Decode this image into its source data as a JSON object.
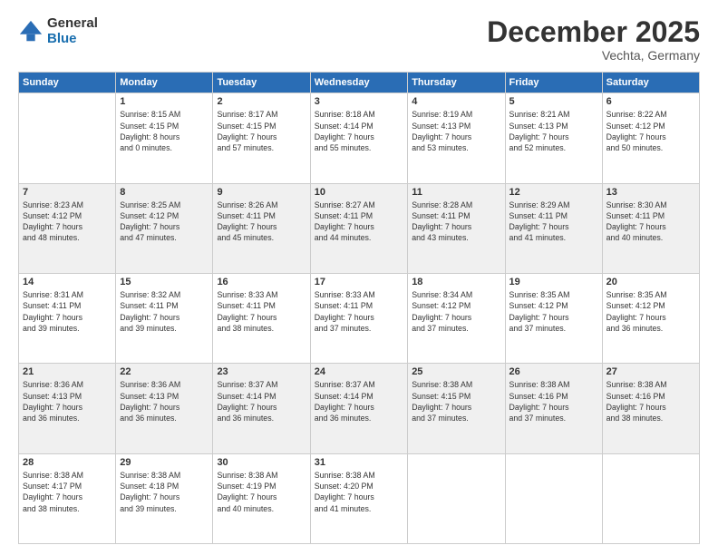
{
  "logo": {
    "general": "General",
    "blue": "Blue"
  },
  "header": {
    "month": "December 2025",
    "location": "Vechta, Germany"
  },
  "weekdays": [
    "Sunday",
    "Monday",
    "Tuesday",
    "Wednesday",
    "Thursday",
    "Friday",
    "Saturday"
  ],
  "weeks": [
    [
      {
        "day": "",
        "sunrise": "",
        "sunset": "",
        "daylight": ""
      },
      {
        "day": "1",
        "sunrise": "Sunrise: 8:15 AM",
        "sunset": "Sunset: 4:15 PM",
        "daylight": "Daylight: 8 hours and 0 minutes."
      },
      {
        "day": "2",
        "sunrise": "Sunrise: 8:17 AM",
        "sunset": "Sunset: 4:15 PM",
        "daylight": "Daylight: 7 hours and 57 minutes."
      },
      {
        "day": "3",
        "sunrise": "Sunrise: 8:18 AM",
        "sunset": "Sunset: 4:14 PM",
        "daylight": "Daylight: 7 hours and 55 minutes."
      },
      {
        "day": "4",
        "sunrise": "Sunrise: 8:19 AM",
        "sunset": "Sunset: 4:13 PM",
        "daylight": "Daylight: 7 hours and 53 minutes."
      },
      {
        "day": "5",
        "sunrise": "Sunrise: 8:21 AM",
        "sunset": "Sunset: 4:13 PM",
        "daylight": "Daylight: 7 hours and 52 minutes."
      },
      {
        "day": "6",
        "sunrise": "Sunrise: 8:22 AM",
        "sunset": "Sunset: 4:12 PM",
        "daylight": "Daylight: 7 hours and 50 minutes."
      }
    ],
    [
      {
        "day": "7",
        "sunrise": "Sunrise: 8:23 AM",
        "sunset": "Sunset: 4:12 PM",
        "daylight": "Daylight: 7 hours and 48 minutes."
      },
      {
        "day": "8",
        "sunrise": "Sunrise: 8:25 AM",
        "sunset": "Sunset: 4:12 PM",
        "daylight": "Daylight: 7 hours and 47 minutes."
      },
      {
        "day": "9",
        "sunrise": "Sunrise: 8:26 AM",
        "sunset": "Sunset: 4:11 PM",
        "daylight": "Daylight: 7 hours and 45 minutes."
      },
      {
        "day": "10",
        "sunrise": "Sunrise: 8:27 AM",
        "sunset": "Sunset: 4:11 PM",
        "daylight": "Daylight: 7 hours and 44 minutes."
      },
      {
        "day": "11",
        "sunrise": "Sunrise: 8:28 AM",
        "sunset": "Sunset: 4:11 PM",
        "daylight": "Daylight: 7 hours and 43 minutes."
      },
      {
        "day": "12",
        "sunrise": "Sunrise: 8:29 AM",
        "sunset": "Sunset: 4:11 PM",
        "daylight": "Daylight: 7 hours and 41 minutes."
      },
      {
        "day": "13",
        "sunrise": "Sunrise: 8:30 AM",
        "sunset": "Sunset: 4:11 PM",
        "daylight": "Daylight: 7 hours and 40 minutes."
      }
    ],
    [
      {
        "day": "14",
        "sunrise": "Sunrise: 8:31 AM",
        "sunset": "Sunset: 4:11 PM",
        "daylight": "Daylight: 7 hours and 39 minutes."
      },
      {
        "day": "15",
        "sunrise": "Sunrise: 8:32 AM",
        "sunset": "Sunset: 4:11 PM",
        "daylight": "Daylight: 7 hours and 39 minutes."
      },
      {
        "day": "16",
        "sunrise": "Sunrise: 8:33 AM",
        "sunset": "Sunset: 4:11 PM",
        "daylight": "Daylight: 7 hours and 38 minutes."
      },
      {
        "day": "17",
        "sunrise": "Sunrise: 8:33 AM",
        "sunset": "Sunset: 4:11 PM",
        "daylight": "Daylight: 7 hours and 37 minutes."
      },
      {
        "day": "18",
        "sunrise": "Sunrise: 8:34 AM",
        "sunset": "Sunset: 4:12 PM",
        "daylight": "Daylight: 7 hours and 37 minutes."
      },
      {
        "day": "19",
        "sunrise": "Sunrise: 8:35 AM",
        "sunset": "Sunset: 4:12 PM",
        "daylight": "Daylight: 7 hours and 37 minutes."
      },
      {
        "day": "20",
        "sunrise": "Sunrise: 8:35 AM",
        "sunset": "Sunset: 4:12 PM",
        "daylight": "Daylight: 7 hours and 36 minutes."
      }
    ],
    [
      {
        "day": "21",
        "sunrise": "Sunrise: 8:36 AM",
        "sunset": "Sunset: 4:13 PM",
        "daylight": "Daylight: 7 hours and 36 minutes."
      },
      {
        "day": "22",
        "sunrise": "Sunrise: 8:36 AM",
        "sunset": "Sunset: 4:13 PM",
        "daylight": "Daylight: 7 hours and 36 minutes."
      },
      {
        "day": "23",
        "sunrise": "Sunrise: 8:37 AM",
        "sunset": "Sunset: 4:14 PM",
        "daylight": "Daylight: 7 hours and 36 minutes."
      },
      {
        "day": "24",
        "sunrise": "Sunrise: 8:37 AM",
        "sunset": "Sunset: 4:14 PM",
        "daylight": "Daylight: 7 hours and 36 minutes."
      },
      {
        "day": "25",
        "sunrise": "Sunrise: 8:38 AM",
        "sunset": "Sunset: 4:15 PM",
        "daylight": "Daylight: 7 hours and 37 minutes."
      },
      {
        "day": "26",
        "sunrise": "Sunrise: 8:38 AM",
        "sunset": "Sunset: 4:16 PM",
        "daylight": "Daylight: 7 hours and 37 minutes."
      },
      {
        "day": "27",
        "sunrise": "Sunrise: 8:38 AM",
        "sunset": "Sunset: 4:16 PM",
        "daylight": "Daylight: 7 hours and 38 minutes."
      }
    ],
    [
      {
        "day": "28",
        "sunrise": "Sunrise: 8:38 AM",
        "sunset": "Sunset: 4:17 PM",
        "daylight": "Daylight: 7 hours and 38 minutes."
      },
      {
        "day": "29",
        "sunrise": "Sunrise: 8:38 AM",
        "sunset": "Sunset: 4:18 PM",
        "daylight": "Daylight: 7 hours and 39 minutes."
      },
      {
        "day": "30",
        "sunrise": "Sunrise: 8:38 AM",
        "sunset": "Sunset: 4:19 PM",
        "daylight": "Daylight: 7 hours and 40 minutes."
      },
      {
        "day": "31",
        "sunrise": "Sunrise: 8:38 AM",
        "sunset": "Sunset: 4:20 PM",
        "daylight": "Daylight: 7 hours and 41 minutes."
      },
      {
        "day": "",
        "sunrise": "",
        "sunset": "",
        "daylight": ""
      },
      {
        "day": "",
        "sunrise": "",
        "sunset": "",
        "daylight": ""
      },
      {
        "day": "",
        "sunrise": "",
        "sunset": "",
        "daylight": ""
      }
    ]
  ]
}
